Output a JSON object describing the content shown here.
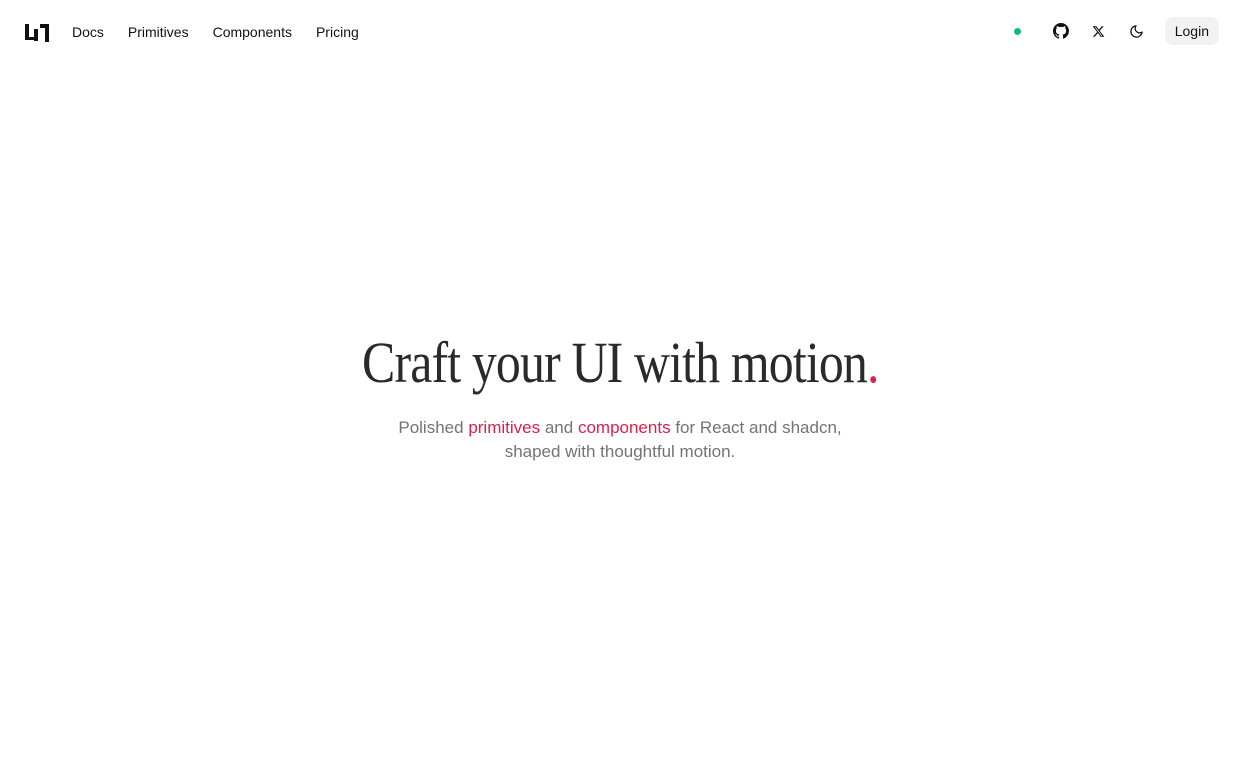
{
  "brand": {
    "logo_icon": "brand-logo-icon"
  },
  "nav": {
    "items": [
      {
        "label": "Docs"
      },
      {
        "label": "Primitives"
      },
      {
        "label": "Components"
      },
      {
        "label": "Pricing"
      }
    ]
  },
  "toolbar": {
    "status_color": "#10b981",
    "github_icon": "github-icon",
    "x_icon": "x-icon",
    "theme_icon": "moon-icon",
    "login_label": "Login"
  },
  "hero": {
    "title": "Craft your UI with motion",
    "title_period": ".",
    "sub_before": "Polished",
    "sub_link1": "primitives",
    "sub_mid": "and",
    "sub_link2": "components",
    "sub_after": "for React and shadcn,",
    "sub_line2": "shaped with thoughtful motion.",
    "accent_color": "#e11d48"
  }
}
